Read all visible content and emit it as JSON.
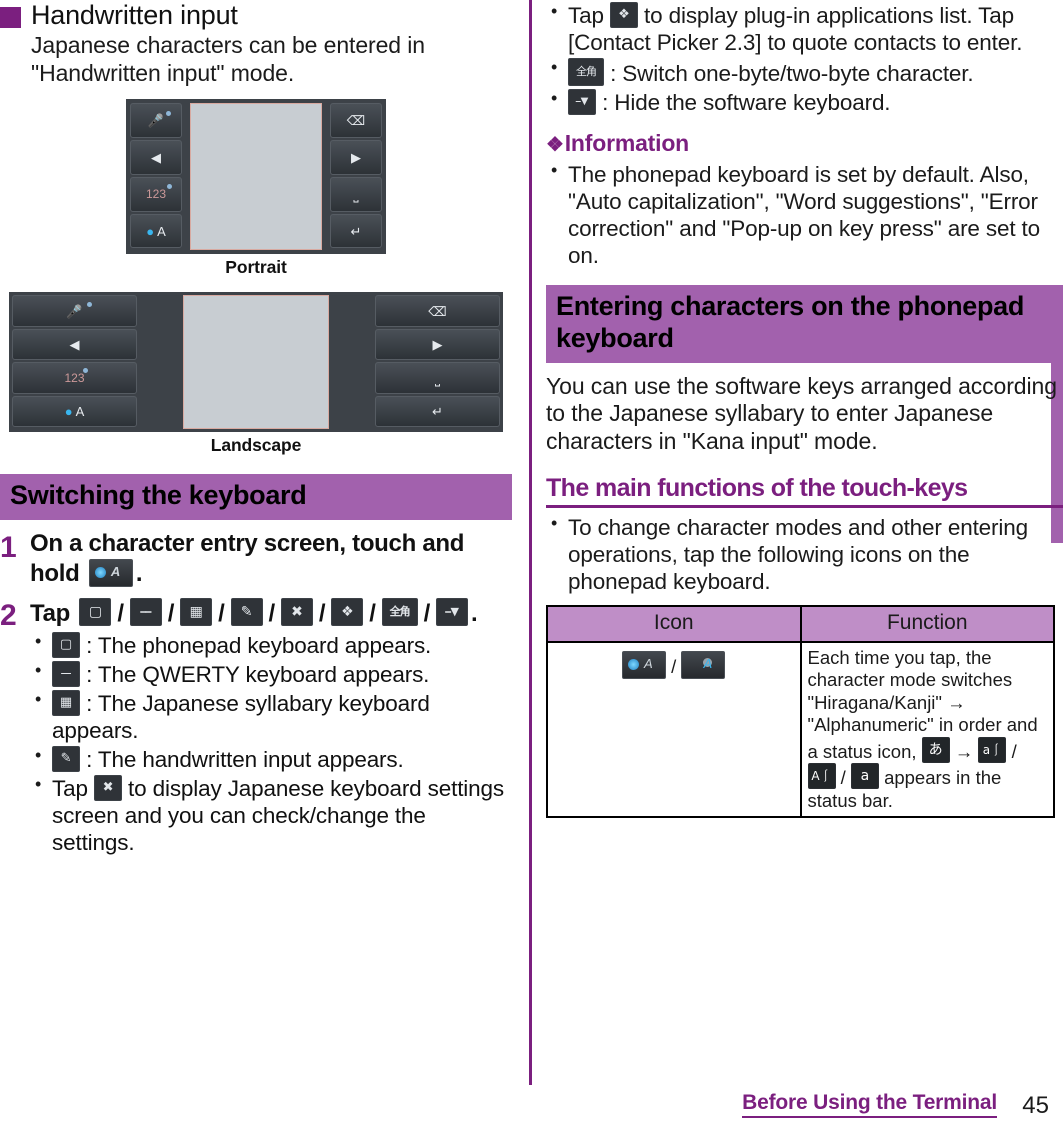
{
  "left": {
    "heading": "Handwritten input",
    "heading_body": "Japanese characters can be entered in \"Handwritten input\" mode.",
    "figures": [
      {
        "caption": "Portrait",
        "orientation": "portrait"
      },
      {
        "caption": "Landscape",
        "orientation": "landscape"
      }
    ],
    "section_bar": "Switching the keyboard",
    "steps": [
      {
        "number": "1",
        "text_before": "On a character entry screen, touch and hold",
        "icon": "character-mode-key-icon",
        "text_after": "."
      },
      {
        "number": "2",
        "text_before": "Tap",
        "icons": [
          "phonepad-keyboard-icon",
          "qwerty-keyboard-icon",
          "japanese-syllabary-keyboard-icon",
          "handwritten-input-icon",
          "keyboard-settings-icon",
          "plugin-applications-icon",
          "full-width-character-icon",
          "hide-keyboard-icon"
        ],
        "separator": "/",
        "text_after": ".",
        "bullets": [
          {
            "icon": "phonepad-keyboard-icon",
            "text": ": The phonepad keyboard appears."
          },
          {
            "icon": "qwerty-keyboard-icon",
            "text": ": The QWERTY keyboard appears."
          },
          {
            "icon": "japanese-syllabary-keyboard-icon",
            "text": ": The Japanese syllabary keyboard appears."
          },
          {
            "icon": "handwritten-input-icon",
            "text": ": The handwritten input appears."
          },
          {
            "icon": "keyboard-settings-icon",
            "text_before": "Tap",
            "text": "to display Japanese keyboard settings screen and you can check/change the settings."
          }
        ]
      }
    ]
  },
  "right": {
    "top_bullets": [
      {
        "icon": "plugin-applications-icon",
        "text_before": "Tap",
        "text": "to display plug-in applications list. Tap [Contact Picker 2.3] to quote contacts to enter."
      },
      {
        "icon": "full-width-character-icon",
        "text": ": Switch one-byte/two-byte character."
      },
      {
        "icon": "hide-keyboard-icon",
        "text": ": Hide the software keyboard."
      }
    ],
    "information": {
      "heading": "Information",
      "marker": "❖",
      "items": [
        "The phonepad keyboard is set by default. Also, \"Auto capitalization\", \"Word suggestions\", \"Error correction\" and \"Pop-up on key press\" are set to on."
      ]
    },
    "section_bar": "Entering characters on the phonepad keyboard",
    "section_body": "You can use the software keys arranged according to the Japanese syllabary to enter Japanese characters in \"Kana input\" mode.",
    "sub_head": "The main functions of the touch-keys",
    "sub_bullets": [
      "To change character modes and other entering operations, tap the following icons on the phonepad keyboard."
    ],
    "table": {
      "headers": [
        "Icon",
        "Function"
      ],
      "rows": [
        {
          "icons": [
            "character-mode-key-icon-hiragana",
            "character-mode-key-icon-alphanumeric"
          ],
          "icon_separator": "/",
          "function_parts": {
            "p1": "Each time you tap, the character mode switches \"Hiragana/Kanji\" ",
            "arrow1": "→",
            "p2": " \"Alphanumeric\" in order and a status icon,",
            "status_icons": [
              "status-icon-hiragana",
              "status-icon-kana",
              "status-icon-alpha-upper",
              "status-icon-alpha-lower"
            ],
            "arrow2": "→",
            "sep": "/",
            "p3": "appears in the status bar."
          }
        }
      ]
    }
  },
  "footer": {
    "section": "Before Using the Terminal",
    "page": "45"
  },
  "colors": {
    "accent_dark": "#7b1f7f",
    "accent_bar": "#a261ad",
    "table_header": "#bf8ec7",
    "text": "#1b1b1b"
  },
  "icon_glyphs": {
    "phonepad-keyboard-icon": "▁",
    "qwerty-keyboard-icon": "⌨",
    "japanese-syllabary-keyboard-icon": "▦",
    "handwritten-input-icon": "✎",
    "keyboard-settings-icon": "✂",
    "plugin-applications-icon": "❖",
    "full-width-character-icon": "全角",
    "hide-keyboard-icon": "⌨",
    "status-icon-hiragana": "あ",
    "status-icon-kana": "a",
    "status-icon-alpha-upper": "A",
    "status-icon-alpha-lower": "a"
  }
}
